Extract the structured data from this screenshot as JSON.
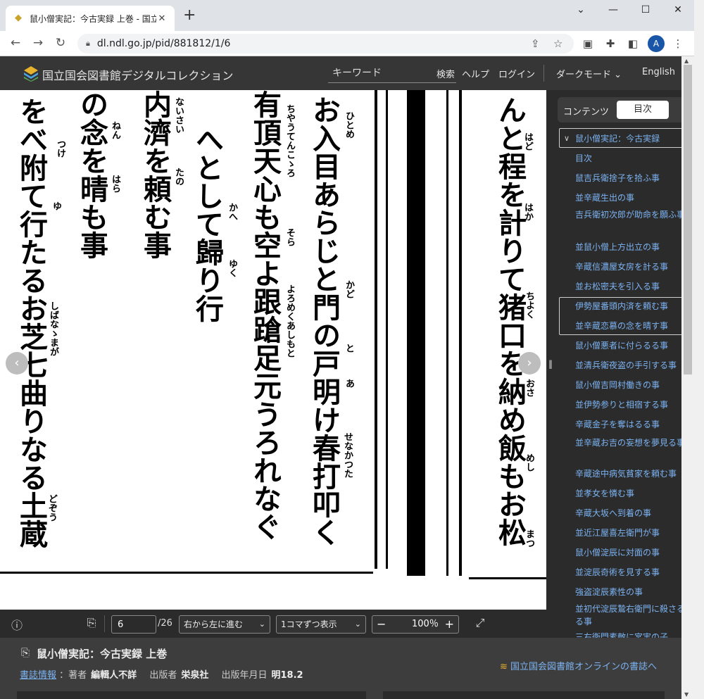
{
  "browser": {
    "tab_title": "鼠小僧実記：今古実録 上巻 - 国立",
    "url": "dl.ndl.go.jp/pid/881812/1/6",
    "profile_initial": "A"
  },
  "site": {
    "title": "国立国会図書館デジタルコレクション",
    "search_placeholder": "キーワード",
    "search_label": "検索",
    "help_label": "ヘルプ",
    "login_label": "ログイン",
    "darkmode_label": "ダークモード",
    "language_label": "English"
  },
  "panel": {
    "tab_contents": "コンテンツ",
    "tab_toc": "目次",
    "tab_more": "目",
    "toc_root": "鼠小僧実記：今古実録",
    "toc_items": [
      "目次",
      "鼠吉兵衛捨子を拾ふ事",
      "並辛蔵生出の事",
      "吉兵衛初次郎が助命を願ふ事",
      "並鼠小僧上方出立の事",
      "辛蔵信濃屋女房を計る事",
      "並お松密夫を引入る事",
      "伊勢屋番頭内済を頼む事",
      "並辛蔵恋慕の念を晴す事",
      "鼠小僧悪者に付らるる事",
      "並清兵衛夜盗の手引する事",
      "鼠小僧吉岡村働きの事",
      "並伊勢参りと相宿する事",
      "辛蔵金子を奪はるる事",
      "並辛蔵お吉の妄想を夢見る事",
      "辛蔵途中病気貧家を頼む事",
      "並孝女を憐む事",
      "辛蔵大坂へ到着の事",
      "並近江屋喜左衛門が事",
      "鼠小僧淀辰に対面の事",
      "並淀辰奇術を見する事",
      "強盗淀辰素性の事",
      "並初代淀辰鷙右衛門に殺さるる事",
      "三右衛門素敵に宮実の子"
    ]
  },
  "viewer": {
    "page_value": "6",
    "page_total": "/26",
    "direction_label": "右から左に進む",
    "display_label": "1コマずつ表示",
    "zoom_label": "100％",
    "columns": [
      "んと程を計りて猪口を納め飯もお松",
      "お入目あらじと門の戸明け春打叩く",
      "有頂天心も空よ跟蹌足元うろれなぐ",
      "へとして歸り行",
      "内濟を頼む事",
      "の念を晴も事",
      "をべ附て行たるお芝七曲りなる土蔵"
    ],
    "ruby": [
      "はど",
      "はか",
      "ちよく",
      "おさ",
      "めし",
      "まつ",
      "ひとめ",
      "かど",
      "と",
      "あ",
      "せなかつた",
      "ちやうてんこゝろ",
      "そら",
      "よろめくあしもと",
      "かへ",
      "ゆく",
      "ないさい",
      "たの",
      "ねん",
      "はら",
      "つけ",
      "ゆ",
      "しばなゝまが",
      "どぞう"
    ]
  },
  "info": {
    "title": "鼠小僧実記：今古実録 上巻",
    "biblio_link": "書誌情報",
    "author_key": "：著者",
    "author_val": "編輯人不詳",
    "publisher_key": "出版者",
    "publisher_val": "栄泉社",
    "date_key": "出版年月日",
    "date_val": "明18.2",
    "online_link": "国立国会図書館オンラインの書誌へ"
  },
  "colors": {
    "link": "#7cb3f2",
    "panel_bg": "#2b2b2b",
    "header_bg": "#363636"
  }
}
